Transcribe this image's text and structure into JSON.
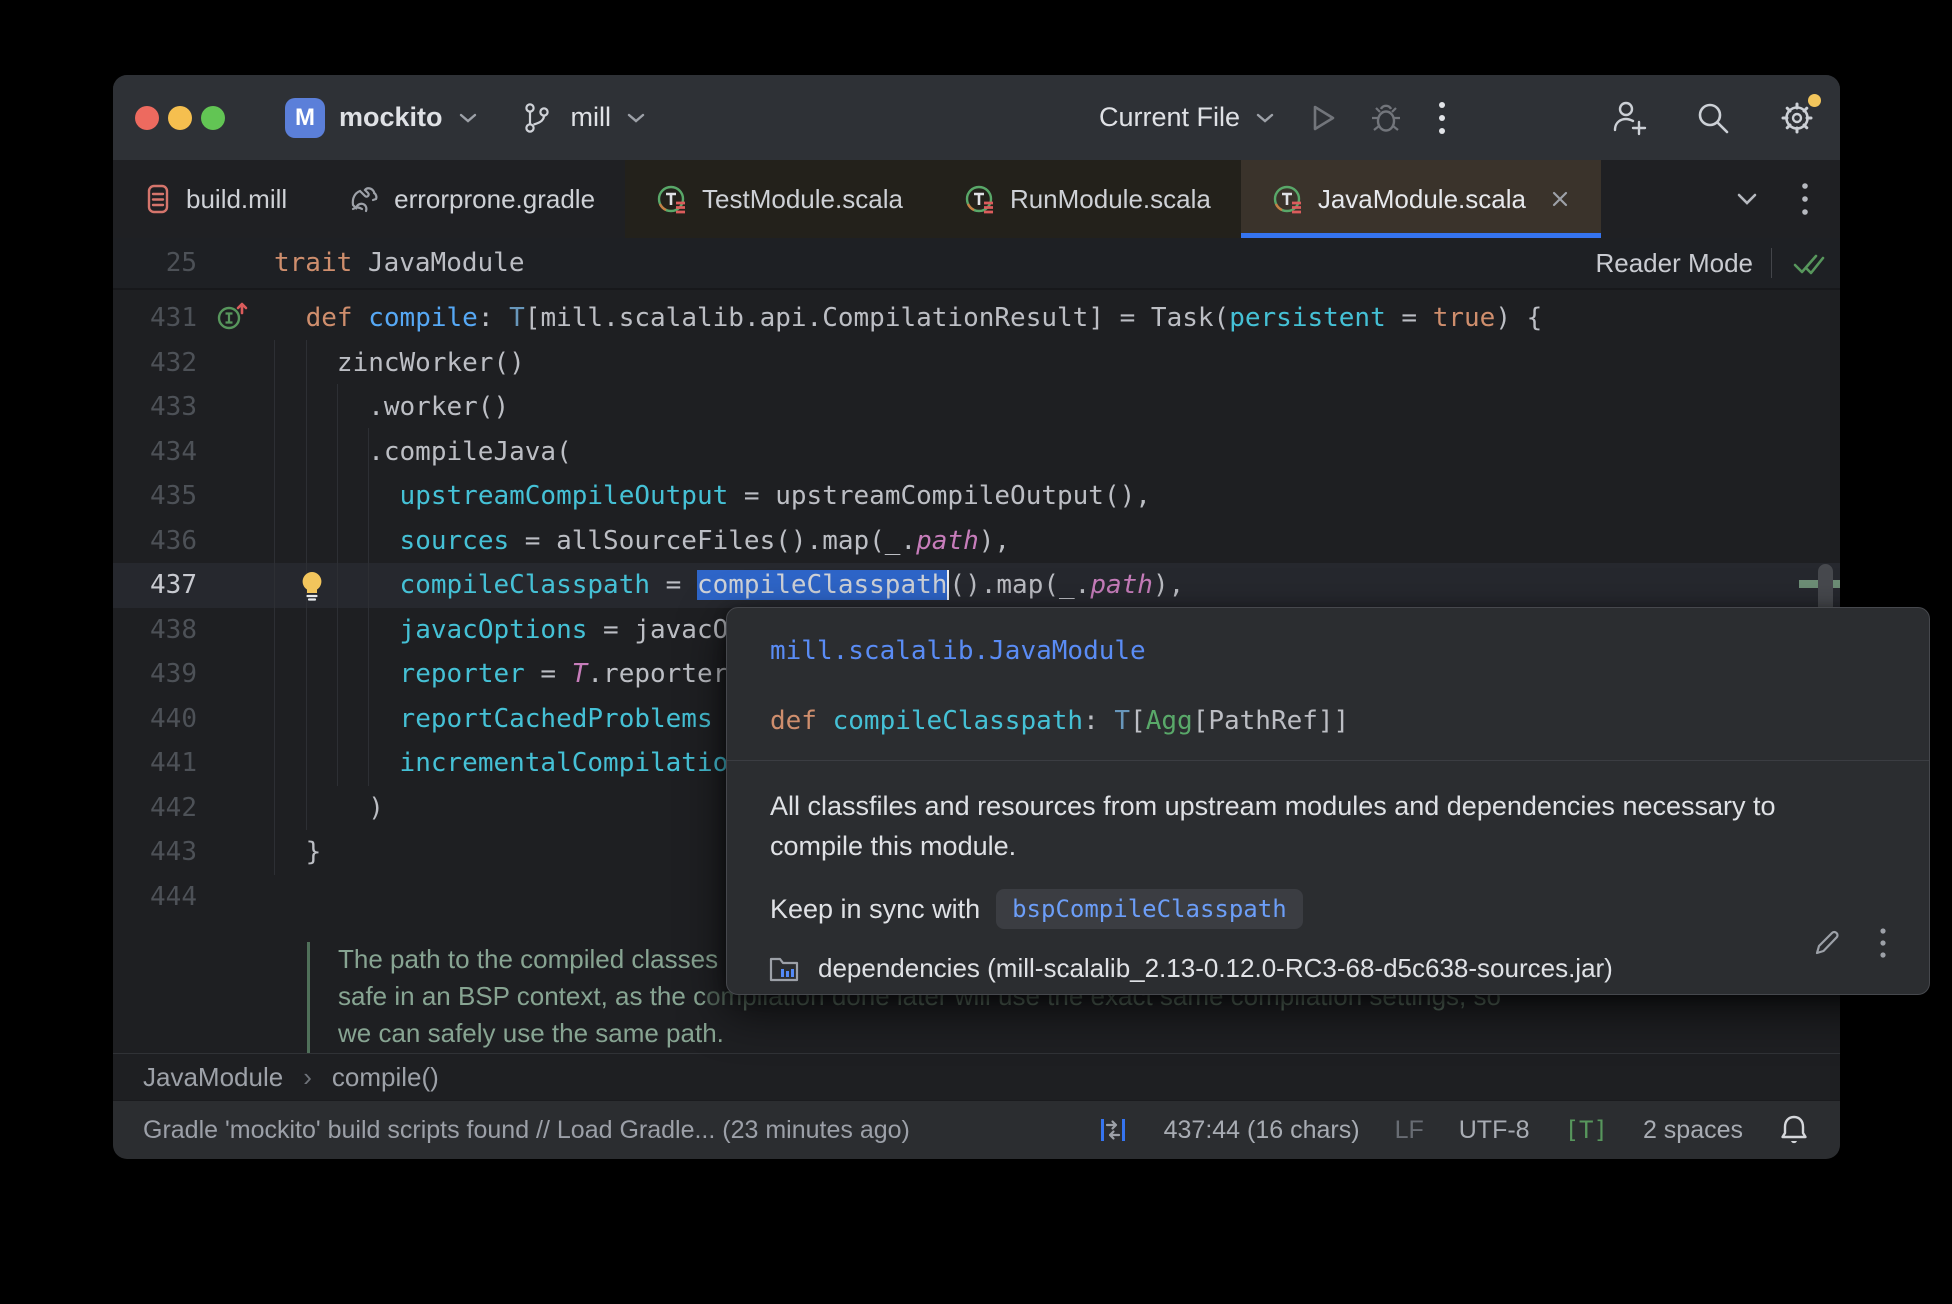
{
  "colors": {
    "accent": "#3574f0",
    "selection": "#2e65c8",
    "traffic_red": "#ed6a5f",
    "traffic_yellow": "#f5bf4f",
    "traffic_green": "#62c554",
    "notification_dot": "#f2c55c"
  },
  "title_bar": {
    "project_initial": "M",
    "project": "mockito",
    "branch": "mill",
    "run_config": "Current File"
  },
  "tab_strip": {
    "tabs": [
      {
        "label": "build.mill"
      },
      {
        "label": "errorprone.gradle"
      },
      {
        "label": "TestModule.scala"
      },
      {
        "label": "RunModule.scala"
      },
      {
        "label": "JavaModule.scala"
      }
    ]
  },
  "sticky": {
    "line_number": "25",
    "reader_mode_label": "Reader Mode",
    "segs": [
      [
        "trait",
        "kw"
      ],
      [
        " JavaModule",
        "d"
      ]
    ]
  },
  "editor": {
    "lines": [
      {
        "num": "431",
        "icon": "override",
        "segs": [
          [
            "    ",
            "d"
          ],
          [
            "def",
            "kw"
          ],
          [
            " ",
            "d"
          ],
          [
            "compile",
            "fn"
          ],
          [
            ": ",
            "d"
          ],
          [
            "T",
            "ty"
          ],
          [
            "[mill.scalalib.api.CompilationResult] = Task(",
            "d"
          ],
          [
            "persistent",
            "pr"
          ],
          [
            " = ",
            "d"
          ],
          [
            "true",
            "kw"
          ],
          [
            ") {",
            "d"
          ]
        ]
      },
      {
        "num": "432",
        "segs": [
          [
            "      zincWorker()",
            "d"
          ]
        ]
      },
      {
        "num": "433",
        "segs": [
          [
            "        .worker()",
            "d"
          ]
        ]
      },
      {
        "num": "434",
        "segs": [
          [
            "        .compileJava(",
            "d"
          ]
        ]
      },
      {
        "num": "435",
        "segs": [
          [
            "          ",
            "d"
          ],
          [
            "upstreamCompileOutput",
            "pr"
          ],
          [
            " = upstreamCompileOutput(),",
            "d"
          ]
        ]
      },
      {
        "num": "436",
        "segs": [
          [
            "          ",
            "d"
          ],
          [
            "sources",
            "pr"
          ],
          [
            " = allSourceFiles().map(_.",
            "d"
          ],
          [
            "path",
            "it"
          ],
          [
            "),",
            "d"
          ]
        ]
      },
      {
        "num": "437",
        "icon": "bulb",
        "current": true,
        "segs": [
          [
            "          ",
            "d"
          ],
          [
            "compileClasspath",
            "pr"
          ],
          [
            " = ",
            "d"
          ],
          [
            "compileClasspath",
            "sel"
          ],
          [
            "().map(_.",
            "d"
          ],
          [
            "path",
            "it"
          ],
          [
            "),",
            "d"
          ]
        ]
      },
      {
        "num": "438",
        "segs": [
          [
            "          ",
            "d"
          ],
          [
            "javacOptions",
            "pr"
          ],
          [
            " = javacO",
            "d"
          ]
        ]
      },
      {
        "num": "439",
        "segs": [
          [
            "          ",
            "d"
          ],
          [
            "reporter",
            "pr"
          ],
          [
            " = ",
            "d"
          ],
          [
            "T",
            "it"
          ],
          [
            ".reporter",
            "d"
          ]
        ]
      },
      {
        "num": "440",
        "segs": [
          [
            "          ",
            "d"
          ],
          [
            "reportCachedProblems",
            "pr"
          ]
        ]
      },
      {
        "num": "441",
        "segs": [
          [
            "          ",
            "d"
          ],
          [
            "incrementalCompilatio",
            "pr"
          ]
        ]
      },
      {
        "num": "442",
        "segs": [
          [
            "        )",
            "d"
          ]
        ]
      },
      {
        "num": "443",
        "segs": [
          [
            "    }",
            "d"
          ]
        ]
      },
      {
        "num": "444",
        "segs": [
          [
            "",
            "d"
          ]
        ]
      }
    ],
    "doc_comment": [
      [
        [
          "The path to the compiled classes",
          "cm"
        ]
      ],
      [
        [
          "safe in an BSP context, as the c",
          "cm"
        ],
        [
          "ompilation done later will use the exact same compilation settings, so",
          "cmdim"
        ]
      ],
      [
        [
          "we can safely use the same path.",
          "cm"
        ]
      ]
    ]
  },
  "popup": {
    "namespace": "mill.scalalib.JavaModule",
    "signature_segs": [
      [
        "def",
        "kw"
      ],
      [
        " ",
        "d"
      ],
      [
        "compileClasspath",
        "pr"
      ],
      [
        ": ",
        "d"
      ],
      [
        "T",
        "ty"
      ],
      [
        "[",
        "d"
      ],
      [
        "Agg",
        "gr"
      ],
      [
        "[PathRef]]",
        "d"
      ]
    ],
    "description_line1": "All classfiles and resources from upstream modules and dependencies necessary to",
    "description_line2": "compile this module.",
    "keep_sync_label": "Keep in sync with",
    "keep_sync_chip": "bspCompileClasspath",
    "source": "dependencies (mill-scalalib_2.13-0.12.0-RC3-68-d5c638-sources.jar)"
  },
  "breadcrumbs": {
    "items": [
      {
        "label": "JavaModule"
      },
      {
        "label": "compile()"
      }
    ],
    "separator": "›"
  },
  "status_bar": {
    "message": "Gradle 'mockito' build scripts found // Load Gradle... (23 minutes ago)",
    "position": "437:44 (16 chars)",
    "line_separator": "LF",
    "encoding": "UTF-8",
    "readonly_badge": "[T]",
    "indent": "2 spaces"
  }
}
